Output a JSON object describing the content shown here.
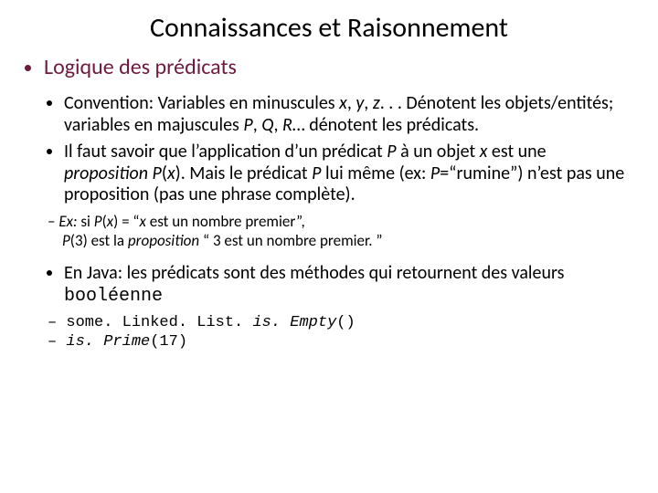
{
  "title": "Connaissances et Raisonnement",
  "section": "Logique des prédicats",
  "b1": {
    "pre1": "Convention: Variables en minuscules ",
    "vx": "x",
    "c1": ", ",
    "vy": "y",
    "c2": ", ",
    "vz": "z",
    "mid": ". . . Dénotent les objets/entités; variables en majuscules ",
    "vP": "P",
    "c3": ", ",
    "vQ": "Q",
    "c4": ", ",
    "vR": "R",
    "post": "… dénotent les prédicats."
  },
  "b2": {
    "t1": "Il faut savoir que l’application d’un prédicat ",
    "P1": "P",
    "t2": " à un  objet ",
    "x1": "x",
    "t3": " est une ",
    "prop": "proposition ",
    "Px": "P",
    "open": "(",
    "x2": "x",
    "close": ")",
    "t4": ".  Mais le prédicat ",
    "P2": "P",
    "t5": " lui même (ex: ",
    "P3": "P",
    "eq": "=“rumine”) n’est pas une proposition (pas une phrase complète)."
  },
  "ex": {
    "lead": "Ex: ",
    "si": "si ",
    "P": "P",
    "o": "(",
    "x": "x",
    "c": ")",
    "eq": " = “",
    "xq": "x",
    "rest1": " est un nombre premier”,",
    "P2": "P",
    "o2": "(",
    "n3": "3",
    "c2": ")",
    "rest2": " est la ",
    "propw": "proposition",
    "rest3": " “ 3 est un nombre premier. ”"
  },
  "java": {
    "t1": "En Java: les prédicats sont des méthodes qui retournent des valeurs ",
    "bool": "booléenne"
  },
  "code": {
    "l1a": "some. Linked. List. ",
    "l1b": "is. Empty",
    "l1c": "()",
    "l2a": "is. Prime",
    "l2b": "(17)"
  }
}
